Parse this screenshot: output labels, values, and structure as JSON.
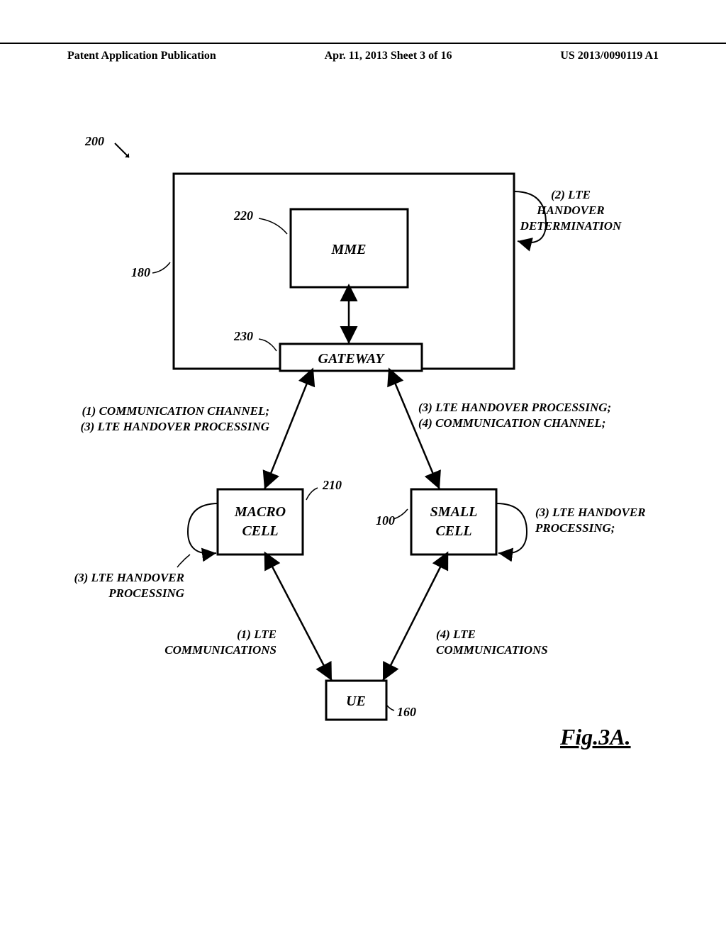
{
  "header": {
    "left": "Patent Application Publication",
    "center": "Apr. 11, 2013  Sheet 3 of 16",
    "right": "US 2013/0090119 A1"
  },
  "refs": {
    "r200": "200",
    "r180": "180",
    "r220": "220",
    "r230": "230",
    "r210": "210",
    "r100": "100",
    "r160": "160"
  },
  "boxes": {
    "mme": "MME",
    "gateway": "GATEWAY",
    "macrocell": "MACRO\nCELL",
    "smallcell": "SMALL\nCELL",
    "ue": "UE"
  },
  "annotations": {
    "a2_line1": "(2) LTE",
    "a2_line2": "HANDOVER",
    "a2_line3": "DETERMINATION",
    "leftmid_line1": "(1) COMMUNICATION CHANNEL;",
    "leftmid_line2": "(3) LTE HANDOVER PROCESSING",
    "rightmid_line1": "(3) LTE HANDOVER PROCESSING;",
    "rightmid_line2": "(4) COMMUNICATION CHANNEL;",
    "leftcell_line1": "(3) LTE HANDOVER",
    "leftcell_line2": "PROCESSING",
    "rightcell_line1": "(3) LTE HANDOVER",
    "rightcell_line2": "PROCESSING;",
    "leftcomm_line1": "(1) LTE",
    "leftcomm_line2": "COMMUNICATIONS",
    "rightcomm_line1": "(4) LTE",
    "rightcomm_line2": "COMMUNICATIONS"
  },
  "figure": "Fig.3A."
}
